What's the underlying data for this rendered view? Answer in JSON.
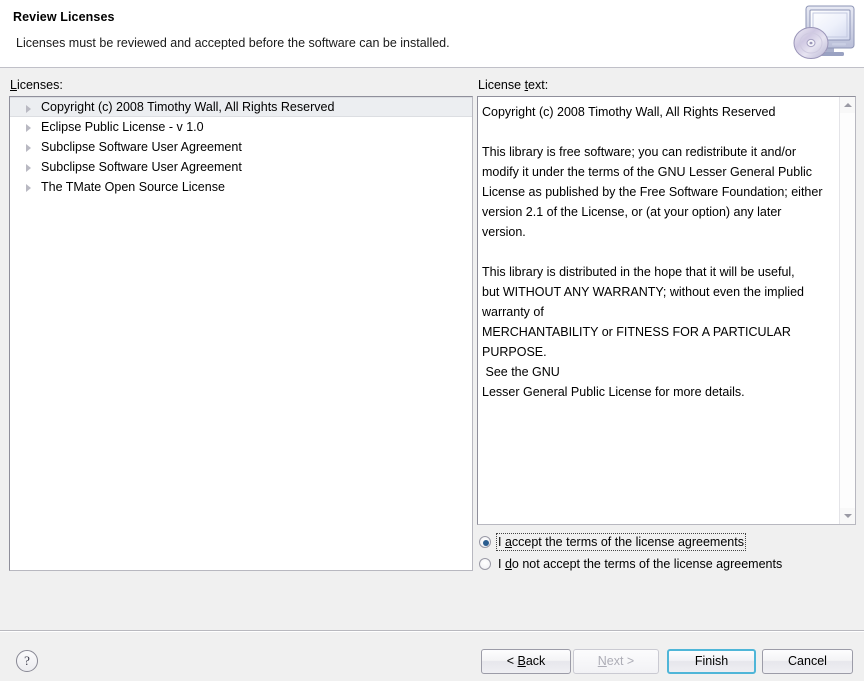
{
  "header": {
    "title": "Review Licenses",
    "description": "Licenses must be reviewed and accepted before the software can be installed.",
    "icon": "computer-disc-icon"
  },
  "labels": {
    "licenses": "Licenses:",
    "licenses_mnemonic": "L",
    "license_text": "License text:",
    "license_text_mnemonic": "t"
  },
  "licenses_list": {
    "items": [
      {
        "label": "Copyright (c) 2008 Timothy Wall, All Rights Reserved",
        "selected": true
      },
      {
        "label": "Eclipse Public License - v 1.0",
        "selected": false
      },
      {
        "label": "Subclipse Software User Agreement",
        "selected": false
      },
      {
        "label": "Subclipse Software User Agreement",
        "selected": false
      },
      {
        "label": "The TMate Open Source License",
        "selected": false
      }
    ]
  },
  "license_text": {
    "content": "Copyright (c) 2008 Timothy Wall, All Rights Reserved\n\nThis library is free software; you can redistribute it and/or\nmodify it under the terms of the GNU Lesser General Public\nLicense as published by the Free Software Foundation; either\nversion 2.1 of the License, or (at your option) any later\nversion.\n\nThis library is distributed in the hope that it will be useful,\nbut WITHOUT ANY WARRANTY; without even the implied\nwarranty of\nMERCHANTABILITY or FITNESS FOR A PARTICULAR PURPOSE.\n See the GNU\nLesser General Public License for more details."
  },
  "scrollbar": {
    "up_arrow": "scroll-up-icon",
    "down_arrow": "scroll-down-icon"
  },
  "accept_options": [
    {
      "label_prefix": "I ",
      "mnemonic": "a",
      "label_suffix": "ccept the terms of the license agreements",
      "selected": true,
      "focused": true
    },
    {
      "label_prefix": "I ",
      "mnemonic": "d",
      "label_suffix": "o not accept the terms of the license agreements",
      "selected": false,
      "focused": false
    }
  ],
  "footer": {
    "help_label": "?",
    "buttons": [
      {
        "prefix": "< ",
        "mnemonic": "B",
        "suffix": "ack",
        "state": "enabled"
      },
      {
        "prefix": "",
        "mnemonic": "N",
        "suffix": "ext >",
        "state": "disabled"
      },
      {
        "prefix": "Finish",
        "mnemonic": "",
        "suffix": "",
        "state": "default"
      },
      {
        "prefix": "Cancel",
        "mnemonic": "",
        "suffix": "",
        "state": "enabled"
      }
    ]
  },
  "colors": {
    "dialog_background": "#f0f0f0",
    "header_background": "#ffffff",
    "panel_background": "#ffffff",
    "selection_background": "#eceef1",
    "default_button_border": "#4fb6d8",
    "radio_dot": "#2a5d8f"
  }
}
